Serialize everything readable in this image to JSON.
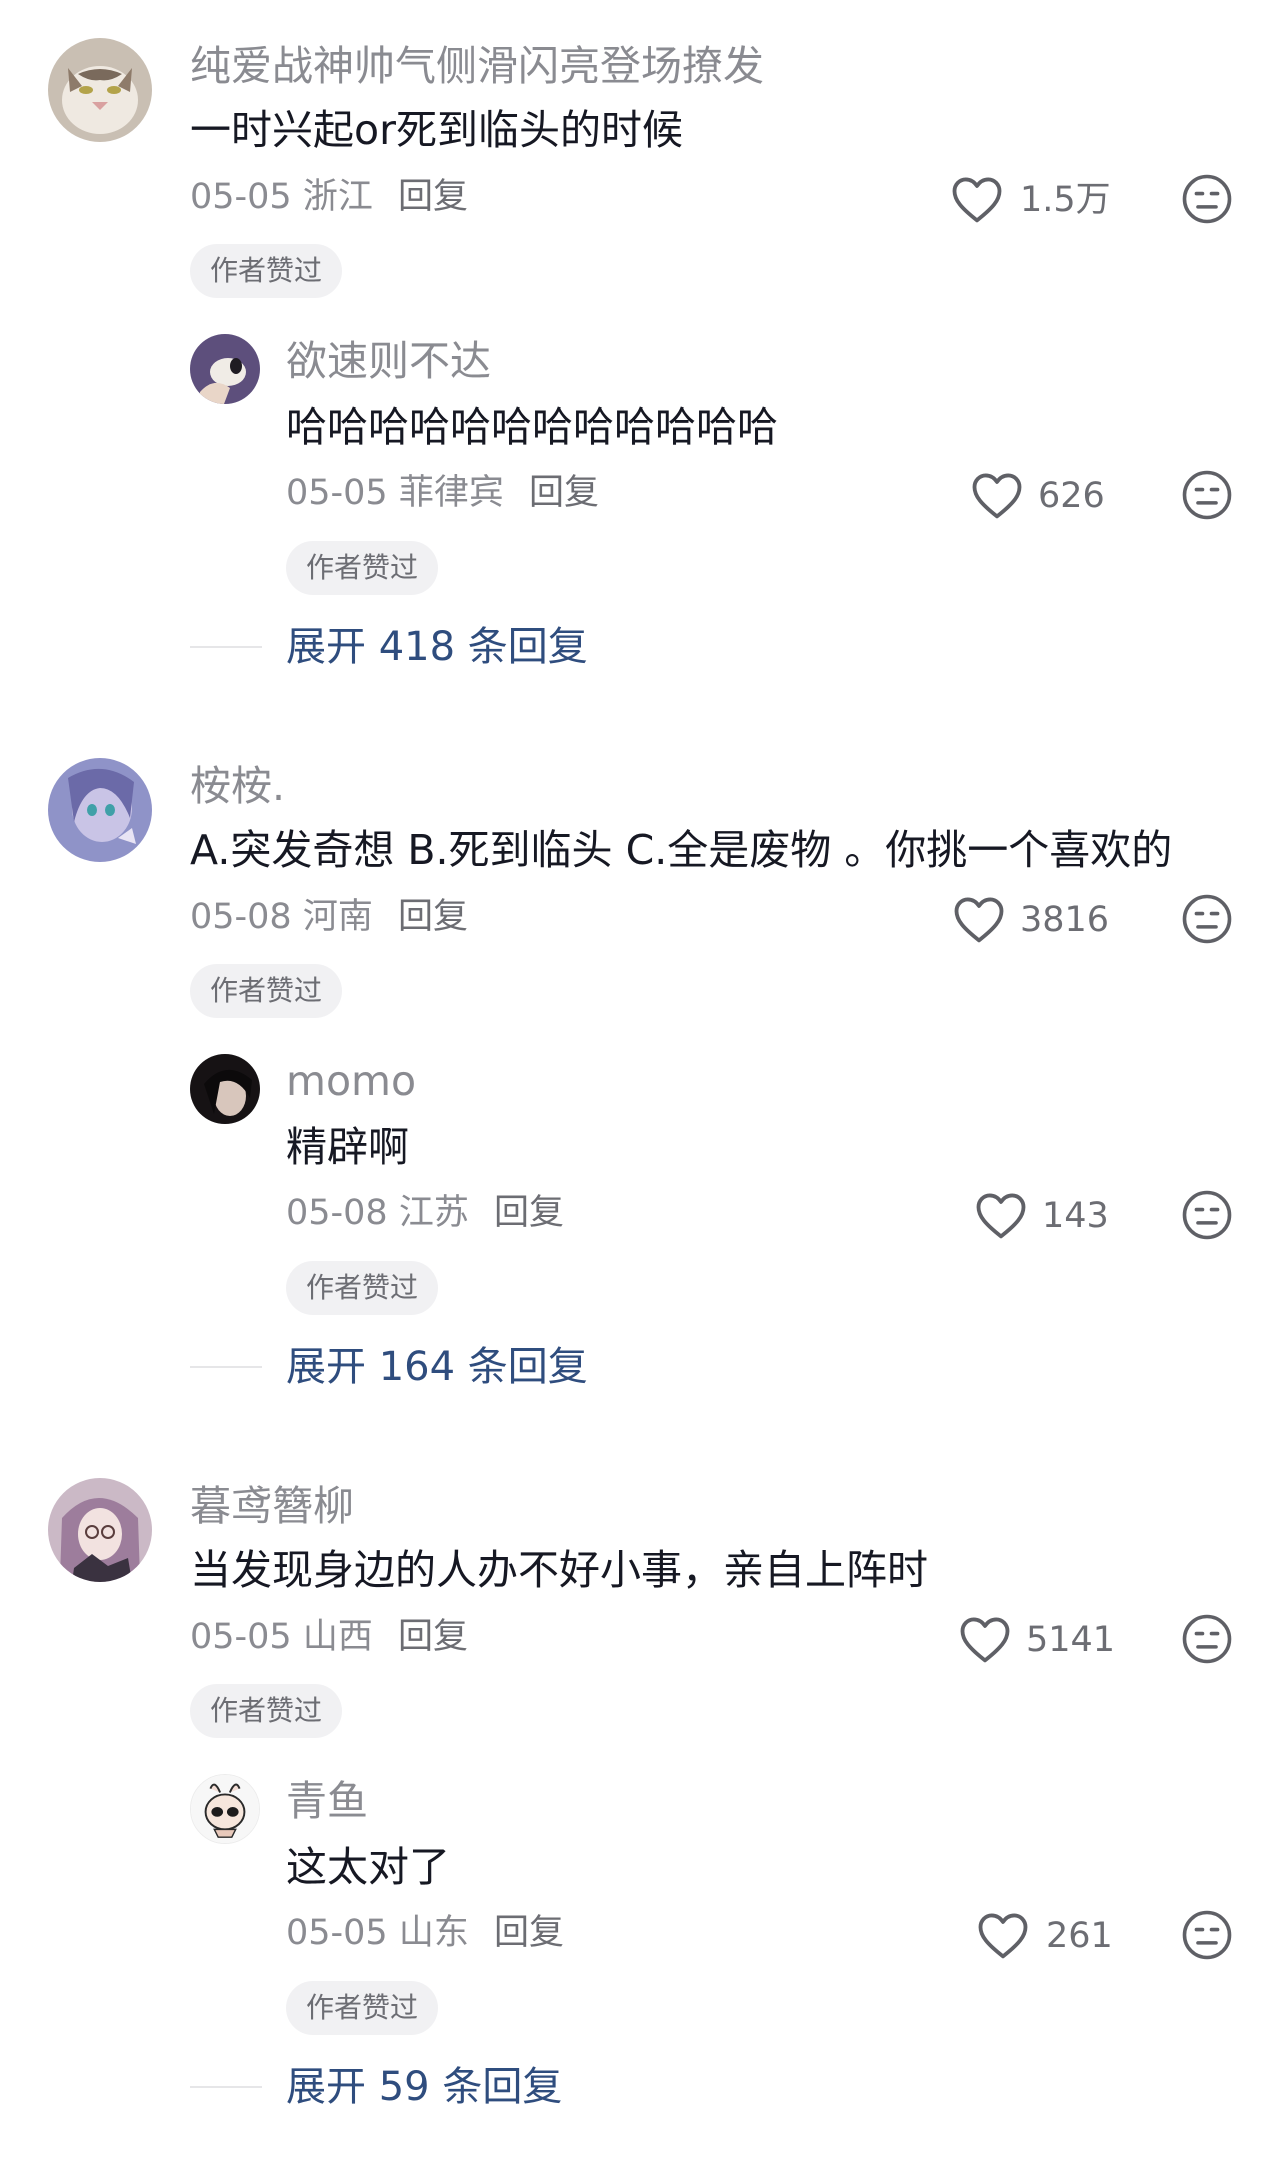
{
  "threads": [
    {
      "comment": {
        "nickname": "纯爱战神帅气侧滑闪亮登场撩发",
        "text": "一时兴起or死到临头的时候",
        "date": "05-05",
        "location": "浙江",
        "reply_label": "回复",
        "likes": "1.5万",
        "badge": "作者赞过",
        "avatar_color": "#b9a897"
      },
      "reply": {
        "nickname": "欲速则不达",
        "text": "哈哈哈哈哈哈哈哈哈哈哈哈",
        "date": "05-05",
        "location": "菲律宾",
        "reply_label": "回复",
        "likes": "626",
        "badge": "作者赞过",
        "avatar_color": "#6a5a86"
      },
      "expand": "展开 418 条回复"
    },
    {
      "comment": {
        "nickname": "桉桉.",
        "text": "A.突发奇想 B.死到临头 C.全是废物 。你挑一个喜欢的",
        "date": "05-08",
        "location": "河南",
        "reply_label": "回复",
        "likes": "3816",
        "badge": "作者赞过",
        "avatar_color": "#8c8fc4"
      },
      "reply": {
        "nickname": "momo",
        "text": "精辟啊",
        "date": "05-08",
        "location": "江苏",
        "reply_label": "回复",
        "likes": "143",
        "badge": "作者赞过",
        "avatar_color": "#2a2424"
      },
      "expand": "展开 164 条回复"
    },
    {
      "comment": {
        "nickname": "暮鸢簪柳",
        "text": "当发现身边的人办不好小事，亲自上阵时",
        "date": "05-05",
        "location": "山西",
        "reply_label": "回复",
        "likes": "5141",
        "badge": "作者赞过",
        "avatar_color": "#b49bb0"
      },
      "reply": {
        "nickname": "青鱼",
        "text": "这太对了",
        "date": "05-05",
        "location": "山东",
        "reply_label": "回复",
        "likes": "261",
        "badge": "作者赞过",
        "avatar_color": "#f2f2f2"
      },
      "expand": "展开 59 条回复"
    }
  ],
  "icons": {
    "like": "heart-outline-icon",
    "more": "meh-face-icon"
  },
  "colors": {
    "text_primary": "#161823",
    "text_secondary": "#8a8b91",
    "expand_link": "#2f4d7e",
    "badge_bg": "#f1f1f3"
  }
}
